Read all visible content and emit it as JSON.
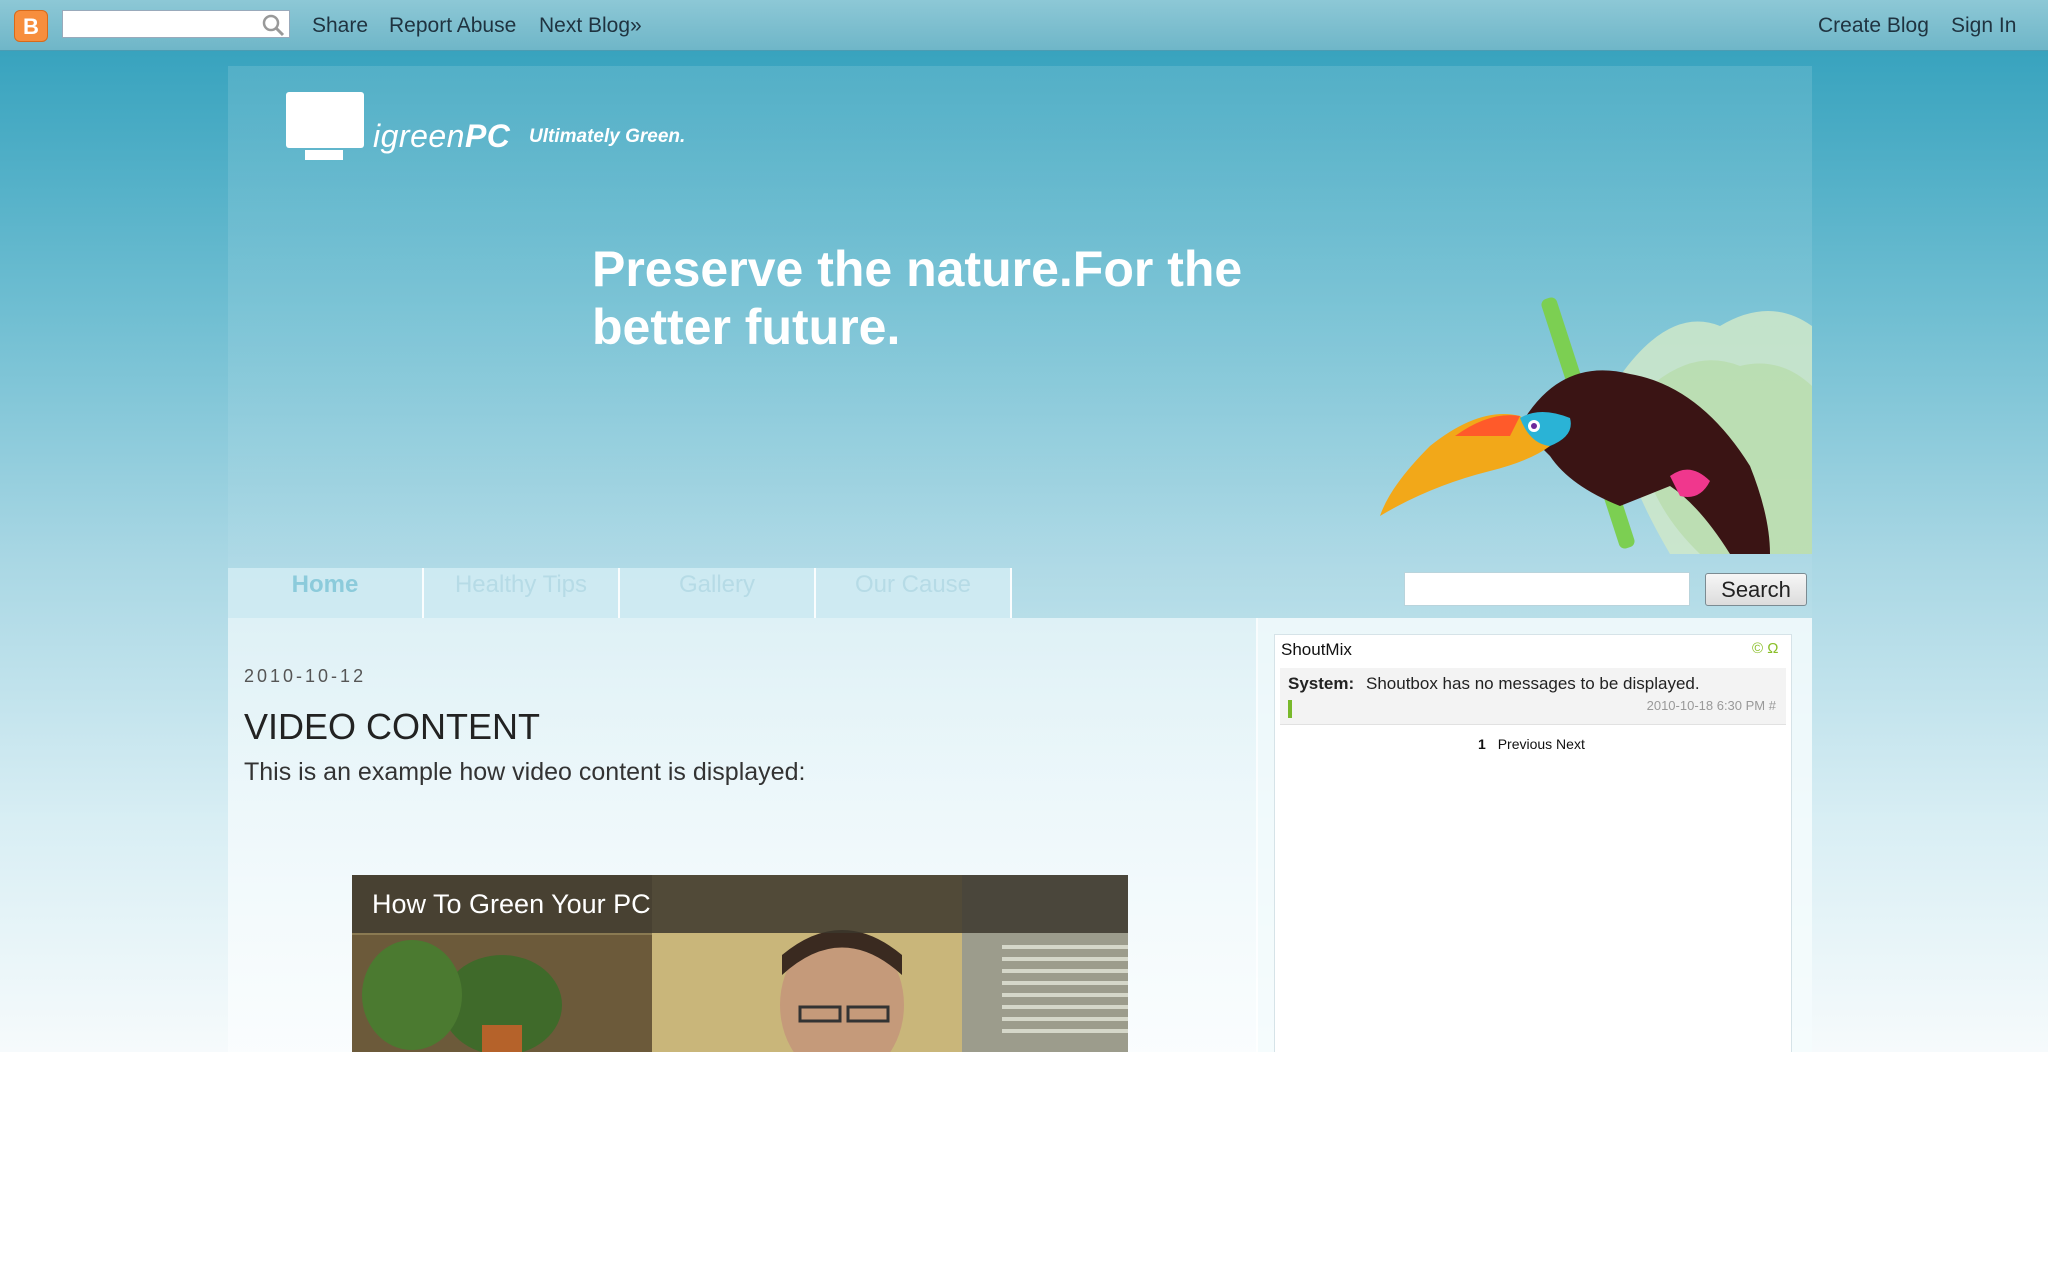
{
  "navbar": {
    "logo_letter": "B",
    "search_placeholder": "",
    "links": {
      "share": "Share",
      "report_abuse": "Report Abuse",
      "next_blog": "Next Blog»",
      "create_blog": "Create Blog",
      "sign_in": "Sign In"
    }
  },
  "header": {
    "logo_text_prefix": "igreen",
    "logo_text_suffix": "PC",
    "tagline": "Ultimately Green.",
    "headline_line1": "Preserve the nature.For the",
    "headline_line2": "better future."
  },
  "nav": {
    "tabs": [
      "Home",
      "Healthy Tips",
      "Gallery",
      "Our Cause"
    ],
    "active_index": 0,
    "search_button": "Search",
    "search_value": ""
  },
  "post": {
    "date": "2010-10-12",
    "title": "VIDEO CONTENT",
    "body": "This is an example how video content is displayed:",
    "video_title": "How To Green Your PC"
  },
  "sidebar": {
    "widget_title": "ShoutMix",
    "message_author": "System:",
    "message_text": "Shoutbox has no messages to be displayed.",
    "message_time": "2010-10-18 6:30 PM",
    "message_hash": "#",
    "pager_current": "1",
    "pager_previous": "Previous",
    "pager_next": "Next"
  },
  "colors": {
    "accent": "#3aa4bf",
    "shout_green": "#79b92b"
  }
}
